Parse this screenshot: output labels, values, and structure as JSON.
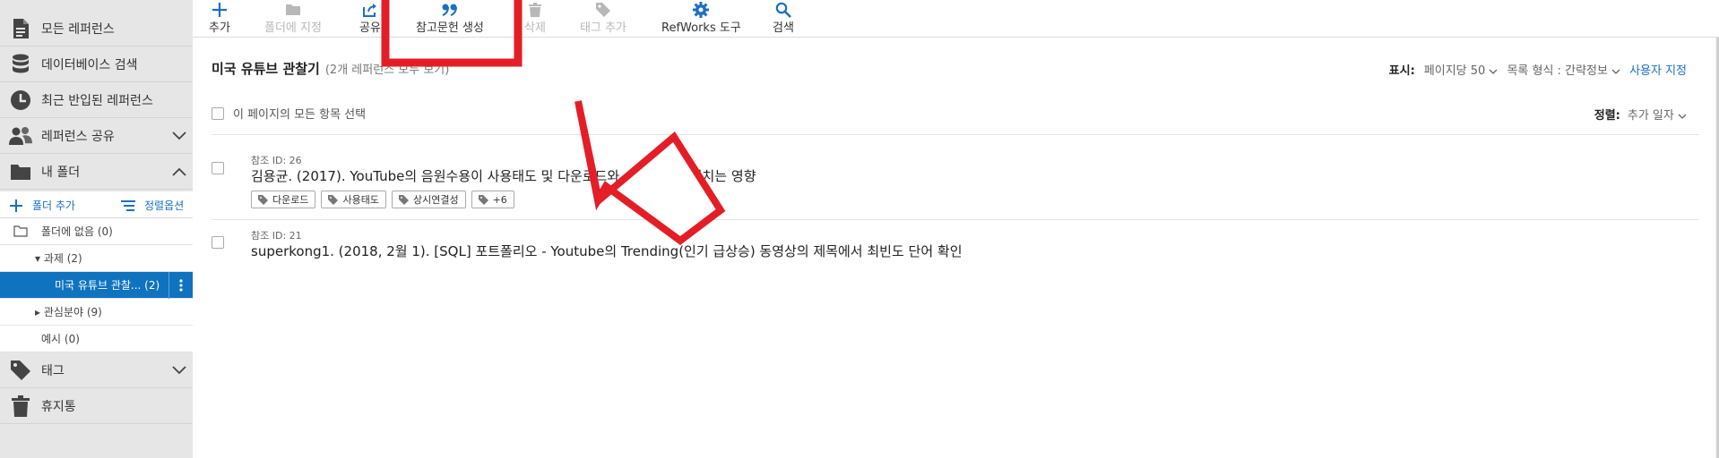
{
  "sidebar": {
    "all_refs": "모든 레퍼런스",
    "db_search": "데이터베이스 검색",
    "recent_imports": "최근 반입된 레퍼런스",
    "share_refs": "레퍼런스 공유",
    "my_folders": "내 폴더",
    "add_folder": "폴더 추가",
    "sort_options": "정렬옵션",
    "folders": [
      {
        "label": "폴더에 없음 (0)"
      },
      {
        "label": "▾ 과제 (2)"
      },
      {
        "label": "미국 유튜브 관찰... (2)"
      },
      {
        "label": "▸ 관심분야 (9)"
      },
      {
        "label": "예시 (0)"
      }
    ],
    "tags": "태그",
    "trash": "휴지통"
  },
  "toolbar": {
    "add": "추가",
    "assign_folder": "폴더에 지정",
    "share": "공유",
    "create_bibliography": "참고문헌 생성",
    "delete": "삭제",
    "add_tag": "태그 추가",
    "refworks_tools": "RefWorks 도구",
    "search": "검색"
  },
  "main": {
    "folder_title": "미국 유튜브 관찰기",
    "folder_subtitle": "(2개 레퍼런스 모두 보기)",
    "display_label": "표시:",
    "per_page": "페이지당 50",
    "list_format": "목록 형식 : 간략정보",
    "customize": "사용자 지정",
    "select_all": "이 페이지의 모든 항목 선택",
    "sort_label": "정렬:",
    "sort_value": "추가 일자"
  },
  "references": [
    {
      "id_label": "참조 ID: 26",
      "title": "김용균. (2017). YouTube의 음원수용이 사용태도 및 다운로드와 스트리밍에 미치는 영향",
      "tags": [
        "다운로드",
        "사용태도",
        "상시연결성",
        "+6"
      ]
    },
    {
      "id_label": "참조 ID: 21",
      "title": "superkong1. (2018, 2월 1). [SQL] 포트폴리오 - Youtube의 Trending(인기 급상승) 동영상의 제목에서 최빈도 단어 확인",
      "tags": []
    }
  ],
  "annotation": {
    "highlight_color": "#e41e26",
    "arrow_fill": "#ffffff",
    "arrow_stroke": "#e41e26"
  }
}
